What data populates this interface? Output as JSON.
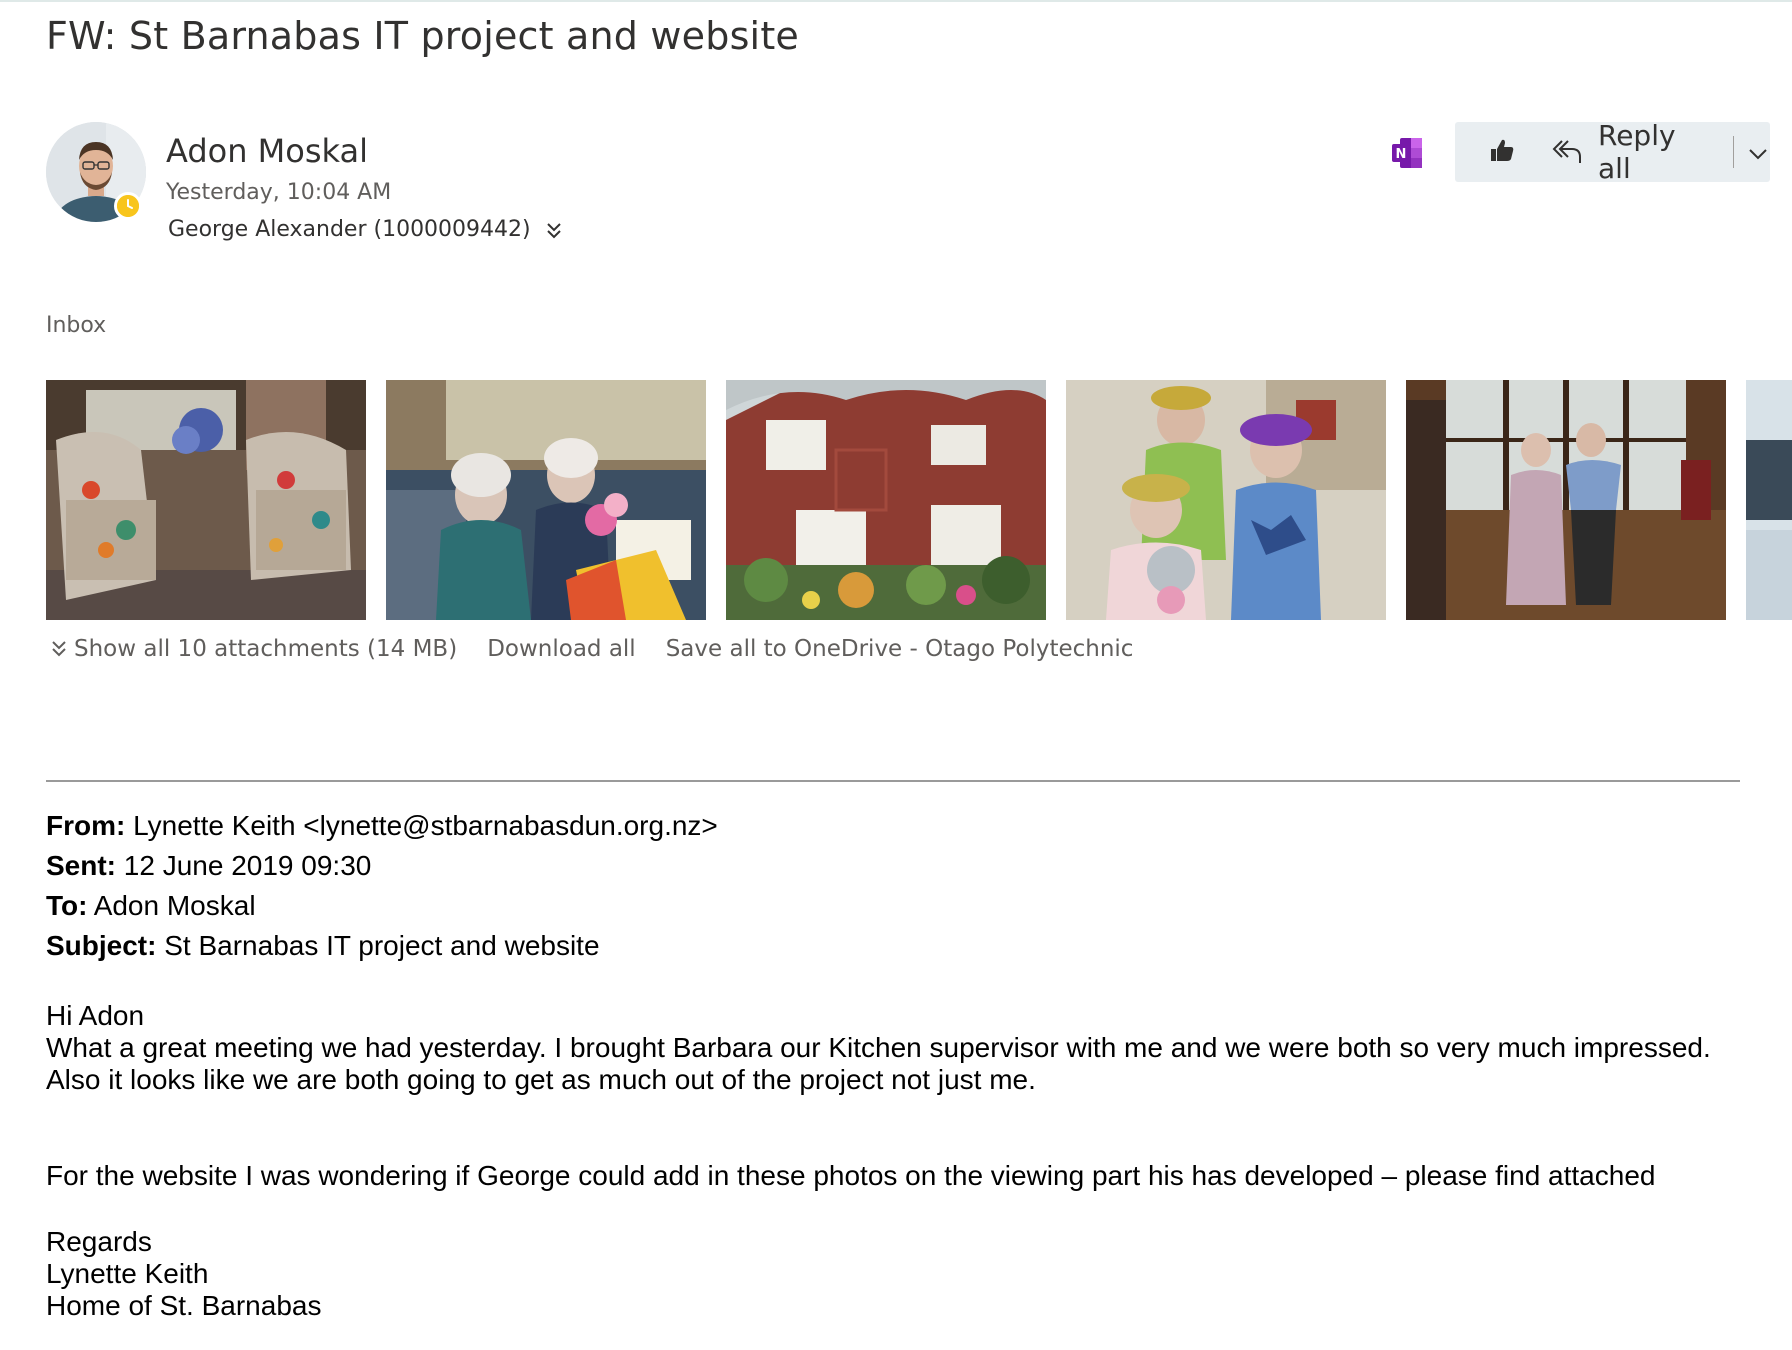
{
  "message": {
    "subject": "FW: St Barnabas IT project and website",
    "sender": {
      "name": "Adon Moskal",
      "sent": "Yesterday, 10:04 AM",
      "to": "George Alexander (1000009442)",
      "presence": "away"
    },
    "folder": "Inbox"
  },
  "actions": {
    "onenote_icon": "onenote-icon",
    "like_icon": "like-icon",
    "reply_all_label": "Reply all",
    "reply_all_icon": "reply-all-icon"
  },
  "attachments": {
    "show_all_label": "Show all 10 attachments (14 MB)",
    "download_all_label": "Download all",
    "save_all_label": "Save all to OneDrive - Otago Polytechnic",
    "thumbnails": [
      "armchairs-photo",
      "ladies-with-flowers-photo",
      "brick-house-photo",
      "ladies-with-tinsel-crowns-photo",
      "dancing-couple-photo",
      "partial-photo"
    ]
  },
  "forwarded": {
    "from_label": "From:",
    "from_value": "Lynette Keith <lynette@stbarnabasdun.org.nz>",
    "sent_label": "Sent:",
    "sent_value": "12 June 2019 09:30",
    "to_label": "To:",
    "to_value": "Adon Moskal",
    "subject_label": "Subject:",
    "subject_value": "St Barnabas IT project and website"
  },
  "body": {
    "greeting": "Hi Adon",
    "paragraph1": "What a great meeting we had yesterday. I brought Barbara our Kitchen supervisor with me and we were both so very much impressed.  Also it looks like we are both going to get as much out of the project not just me.",
    "paragraph2": "For the website I was wondering if George could add in these photos on the viewing part his has developed – please find attached",
    "signoff": "Regards",
    "signature_name": "Lynette Keith",
    "signature_org": "Home of St. Barnabas"
  },
  "colors": {
    "accent_button_bg": "#e9eef1",
    "presence_away": "#f8c51c",
    "onenote_purple": "#7719aa"
  }
}
